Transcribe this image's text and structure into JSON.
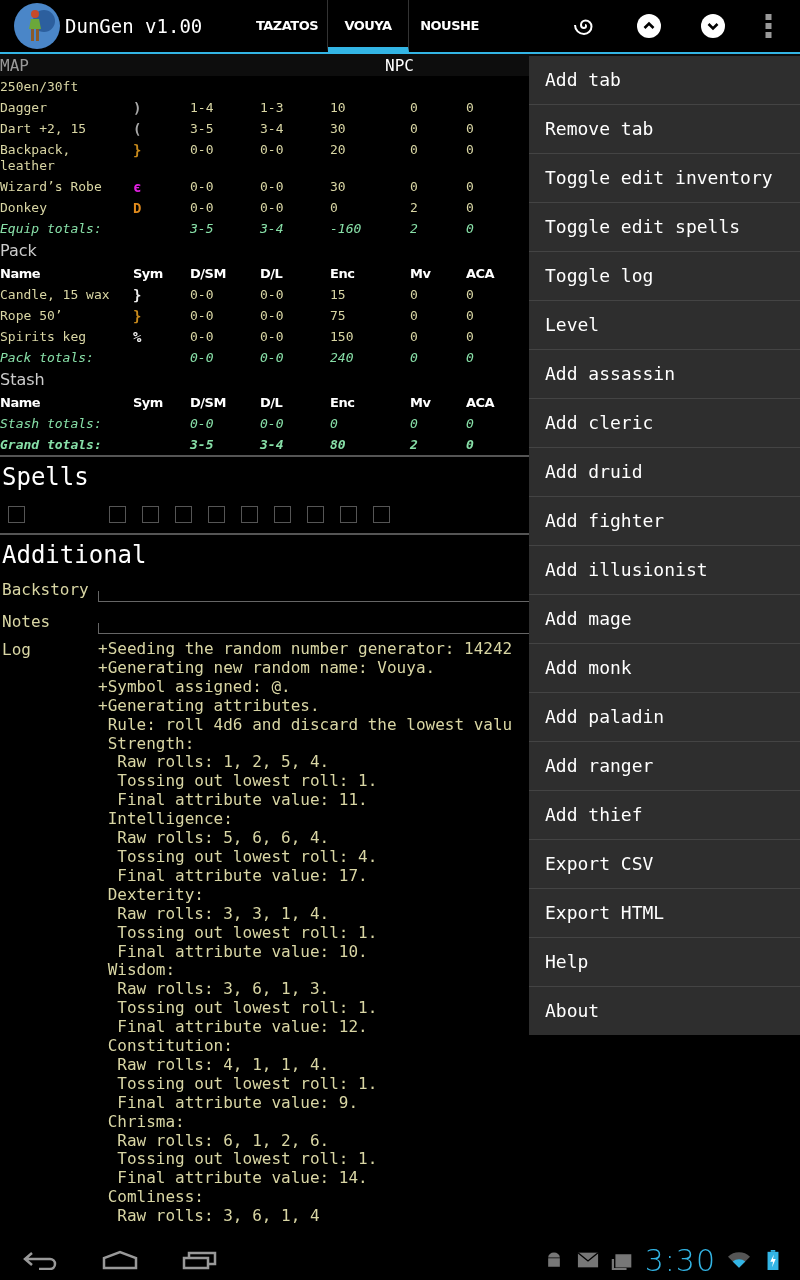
{
  "action_bar": {
    "title": "DunGen v1.00",
    "tabs": [
      {
        "label": "TAZATOS",
        "selected": false
      },
      {
        "label": "VOUYA",
        "selected": true
      },
      {
        "label": "NOUSHE",
        "selected": false
      }
    ]
  },
  "sub_bar": {
    "left": "MAP",
    "center": "NPC"
  },
  "equipment": {
    "rows": [
      {
        "name": "250en/30ft"
      },
      {
        "name": "Dagger",
        "sym": ")",
        "color": "#a8a8a8",
        "values": [
          "1-4",
          "1-3",
          "10",
          "0",
          "0"
        ]
      },
      {
        "name": "Dart +2, 15",
        "sym": "(",
        "color": "#a8a8a8",
        "values": [
          "3-5",
          "3-4",
          "30",
          "0",
          "0"
        ]
      },
      {
        "name": "Backpack, leather",
        "sym": "}",
        "color": "#c88a1c",
        "values": [
          "0-0",
          "0-0",
          "20",
          "0",
          "0"
        ]
      },
      {
        "name": "Wizard’s Robe",
        "sym": "є",
        "color": "#e020e0",
        "values": [
          "0-0",
          "0-0",
          "30",
          "0",
          "0"
        ]
      },
      {
        "name": "Donkey",
        "sym": "D",
        "color": "#e08a1c",
        "values": [
          "0-0",
          "0-0",
          "0",
          "2",
          "0"
        ]
      }
    ],
    "totals": {
      "label": "Equip totals:",
      "values": [
        "3-5",
        "3-4",
        "-160",
        "2",
        "0"
      ]
    }
  },
  "sections": [
    {
      "title": "Pack",
      "columns": [
        "Name",
        "Sym",
        "D/SM",
        "D/L",
        "Enc",
        "Mv",
        "ACA"
      ],
      "rows": [
        {
          "name": "Candle, 15 wax",
          "sym": "}",
          "color": "#f0f0f0",
          "values": [
            "0-0",
            "0-0",
            "15",
            "0",
            "0"
          ]
        },
        {
          "name": "Rope 50’",
          "sym": "}",
          "color": "#c88a1c",
          "values": [
            "0-0",
            "0-0",
            "75",
            "0",
            "0"
          ]
        },
        {
          "name": "Spirits keg",
          "sym": "%",
          "color": "#f0f0f0",
          "values": [
            "0-0",
            "0-0",
            "150",
            "0",
            "0"
          ]
        }
      ],
      "totals": {
        "label": "Pack totals:",
        "values": [
          "0-0",
          "0-0",
          "240",
          "0",
          "0"
        ]
      }
    },
    {
      "title": "Stash",
      "columns": [
        "Name",
        "Sym",
        "D/SM",
        "D/L",
        "Enc",
        "Mv",
        "ACA"
      ],
      "totals": {
        "label": "Stash totals:",
        "values": [
          "0-0",
          "0-0",
          "0",
          "0",
          "0"
        ]
      }
    }
  ],
  "grand_totals": {
    "label": "Grand totals:",
    "values": [
      "3-5",
      "3-4",
      "80",
      "2",
      "0"
    ]
  },
  "spells": {
    "title": "Spells",
    "checkboxes": [
      {
        "checked": false
      },
      {
        "checked": false
      },
      {
        "checked": false
      },
      {
        "checked": false
      },
      {
        "checked": false
      },
      {
        "checked": false
      },
      {
        "checked": false
      },
      {
        "checked": false
      },
      {
        "checked": false
      },
      {
        "checked": false
      }
    ]
  },
  "additional": {
    "title": "Additional",
    "fields": [
      {
        "label": "Backstory"
      },
      {
        "label": "Notes"
      }
    ],
    "log": {
      "label": "Log",
      "lines": [
        "+Seeding the random number generator: 14242",
        "+Generating new random name: Vouya.",
        "+Symbol assigned: @.",
        "+Generating attributes.",
        " Rule: roll 4d6 and discard the lowest valu",
        " Strength:",
        "  Raw rolls: 1, 2, 5, 4.",
        "  Tossing out lowest roll: 1.",
        "  Final attribute value: 11.",
        " Intelligence:",
        "  Raw rolls: 5, 6, 6, 4.",
        "  Tossing out lowest roll: 4.",
        "  Final attribute value: 17.",
        " Dexterity:",
        "  Raw rolls: 3, 3, 1, 4.",
        "  Tossing out lowest roll: 1.",
        "  Final attribute value: 10.",
        " Wisdom:",
        "  Raw rolls: 3, 6, 1, 3.",
        "  Tossing out lowest roll: 1.",
        "  Final attribute value: 12.",
        " Constitution:",
        "  Raw rolls: 4, 1, 1, 4.",
        "  Tossing out lowest roll: 1.",
        "  Final attribute value: 9.",
        " Chrisma:",
        "  Raw rolls: 6, 1, 2, 6.",
        "  Tossing out lowest roll: 1.",
        "  Final attribute value: 14.",
        " Comliness:",
        "  Raw rolls: 3, 6, 1, 4"
      ]
    }
  },
  "menu": {
    "items": [
      "Add tab",
      "Remove tab",
      "Toggle edit inventory",
      "Toggle edit spells",
      "Toggle log",
      "Level",
      "Add assassin",
      "Add cleric",
      "Add druid",
      "Add fighter",
      "Add illusionist",
      "Add mage",
      "Add monk",
      "Add paladin",
      "Add ranger",
      "Add thief",
      "Export CSV",
      "Export HTML",
      "Help",
      "About"
    ]
  },
  "status_bar": {
    "time": "3:30"
  }
}
